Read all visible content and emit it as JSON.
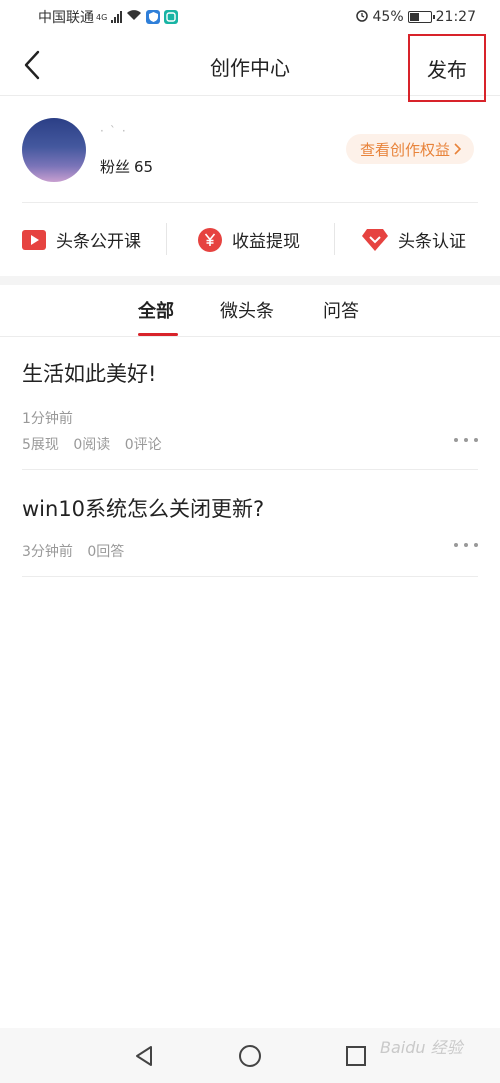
{
  "status_bar": {
    "carrier": "中国联通",
    "network": "4G",
    "battery": "45%",
    "battery_level": 0.45,
    "time": "21:27"
  },
  "header": {
    "title": "创作中心",
    "publish_label": "发布"
  },
  "profile": {
    "username": "·`·",
    "fans_label": "粉丝",
    "fans_count": "65",
    "rights_label": "查看创作权益"
  },
  "quick_actions": [
    {
      "label": "头条公开课",
      "icon": "play-video-icon",
      "color": "#e64340"
    },
    {
      "label": "收益提现",
      "icon": "yuan-coin-icon",
      "color": "#e64340"
    },
    {
      "label": "头条认证",
      "icon": "diamond-badge-icon",
      "color": "#e64340"
    }
  ],
  "tabs": [
    {
      "label": "全部",
      "active": true
    },
    {
      "label": "微头条",
      "active": false
    },
    {
      "label": "问答",
      "active": false
    }
  ],
  "articles": [
    {
      "title": "生活如此美好!",
      "time": "1分钟前",
      "stats": [
        "5展现",
        "0阅读",
        "0评论"
      ]
    },
    {
      "title": "win10系统怎么关闭更新?",
      "time": "3分钟前",
      "stats": [
        "0回答"
      ]
    }
  ],
  "watermark": "Baidu 经验",
  "colors": {
    "accent": "#d8232a",
    "rights_text": "#e8833a",
    "rights_bg": "#fdf1e9"
  }
}
